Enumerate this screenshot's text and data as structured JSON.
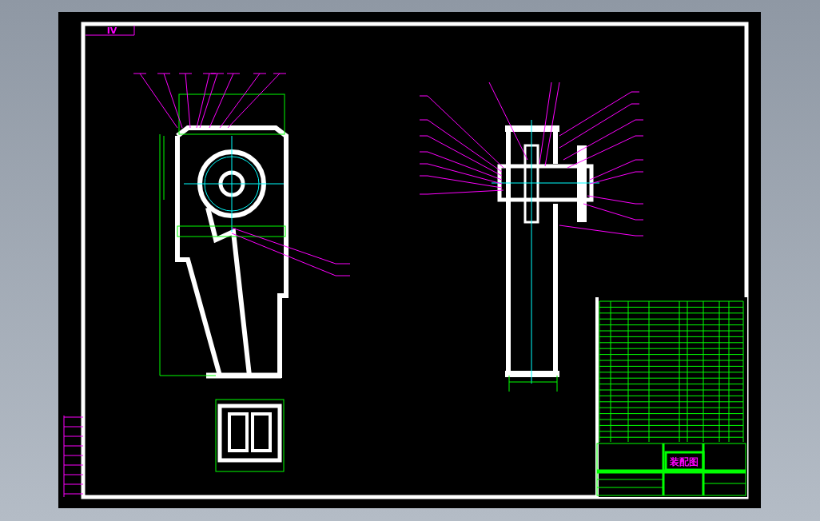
{
  "sheet": {
    "zone_label": "IV"
  },
  "title_block": {
    "title": "装配图"
  }
}
